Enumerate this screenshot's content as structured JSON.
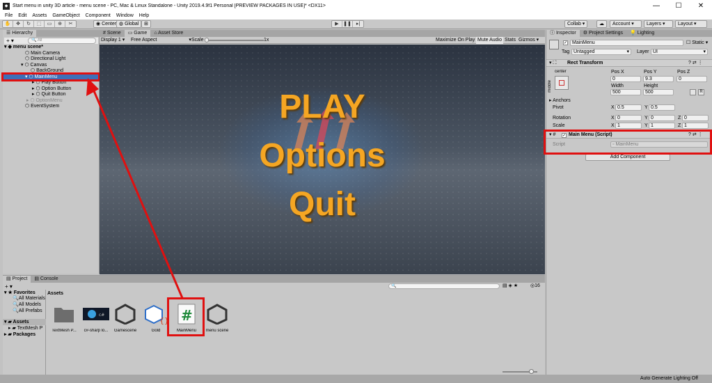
{
  "window": {
    "title": "Start menu in unity 3D article - menu scene - PC, Mac & Linux Standalone - Unity 2019.4.9f1 Personal [PREVIEW PACKAGES IN USE]* <DX11>",
    "minimize": "—",
    "maximize": "☐",
    "close": "✕"
  },
  "menubar": [
    "File",
    "Edit",
    "Assets",
    "GameObject",
    "Component",
    "Window",
    "Help"
  ],
  "toolbar": {
    "pivot": "Center",
    "space": "Global",
    "collab": "Collab ▾",
    "account": "Account",
    "layers": "Layers",
    "layout": "Layout"
  },
  "hierarchy": {
    "tab": "Hierarchy",
    "search_placeholder": "All",
    "items": [
      {
        "label": "menu scene*"
      },
      {
        "label": "Main Camera"
      },
      {
        "label": "Directional Light"
      },
      {
        "label": "Canvas"
      },
      {
        "label": "BackGround"
      },
      {
        "label": "MainMenu"
      },
      {
        "label": "Play Button"
      },
      {
        "label": "Option Button"
      },
      {
        "label": "Quit Button"
      },
      {
        "label": "OptionMenu"
      },
      {
        "label": "EventSystem"
      }
    ]
  },
  "gameview": {
    "tabs": [
      "Scene",
      "Game",
      "Asset Store"
    ],
    "display": "Display 1",
    "aspect": "Free Aspect",
    "scale_label": "Scale",
    "scale_value": "1x",
    "maximize": "Maximize On Play",
    "mute": "Mute Audio",
    "stats": "Stats",
    "gizmos": "Gizmos",
    "menu_items": [
      "PLAY",
      "Options",
      "Quit"
    ]
  },
  "inspector": {
    "tabs": [
      "Inspector",
      "Project Settings",
      "Lighting"
    ],
    "object_name": "MainMenu",
    "static_label": "Static",
    "tag_label": "Tag",
    "tag_value": "Untagged",
    "layer_label": "Layer",
    "layer_value": "UI",
    "rect_transform": "Rect Transform",
    "anchor_h": "center",
    "anchor_v": "middle",
    "pos_x_label": "Pos X",
    "pos_x": "0",
    "pos_y_label": "Pos Y",
    "pos_y": "9.3",
    "pos_z_label": "Pos Z",
    "pos_z": "0",
    "width_label": "Width",
    "width": "500",
    "height_label": "Height",
    "height": "500",
    "anchors_label": "Anchors",
    "pivot_label": "Pivot",
    "pivot_x": "0.5",
    "pivot_y": "0.5",
    "rotation_label": "Rotation",
    "rot_x": "0",
    "rot_y": "0",
    "rot_z": "0",
    "scale_label": "Scale",
    "scale_x": "1",
    "scale_y": "1",
    "scale_z": "1",
    "script_component": "Main Menu (Script)",
    "script_label": "Script",
    "script_value": "MainMenu",
    "add_component": "Add Component"
  },
  "project": {
    "tabs": [
      "Project",
      "Console"
    ],
    "favorites_label": "Favorites",
    "favorites": [
      "All Materials",
      "All Models",
      "All Prefabs"
    ],
    "tree": [
      "Assets",
      "TextMesh P",
      "Packages"
    ],
    "assets_header": "Assets",
    "count": "16",
    "assets": [
      {
        "name": "TextMesh P...",
        "icon": "folder-icon"
      },
      {
        "name": "c#-sharp lo...",
        "icon": "image-icon"
      },
      {
        "name": "Gamescene",
        "icon": "unity-scene-icon"
      },
      {
        "name": "Gold",
        "icon": "prefab-icon"
      },
      {
        "name": "MainMenu",
        "icon": "csharp-script-icon"
      },
      {
        "name": "menu scene",
        "icon": "unity-scene-icon"
      }
    ]
  },
  "status": {
    "right": "Auto Generate Lighting Off"
  },
  "colors": {
    "highlight": "#e01010",
    "selection": "#3d6fb8",
    "menu_text": "#f5a623"
  }
}
